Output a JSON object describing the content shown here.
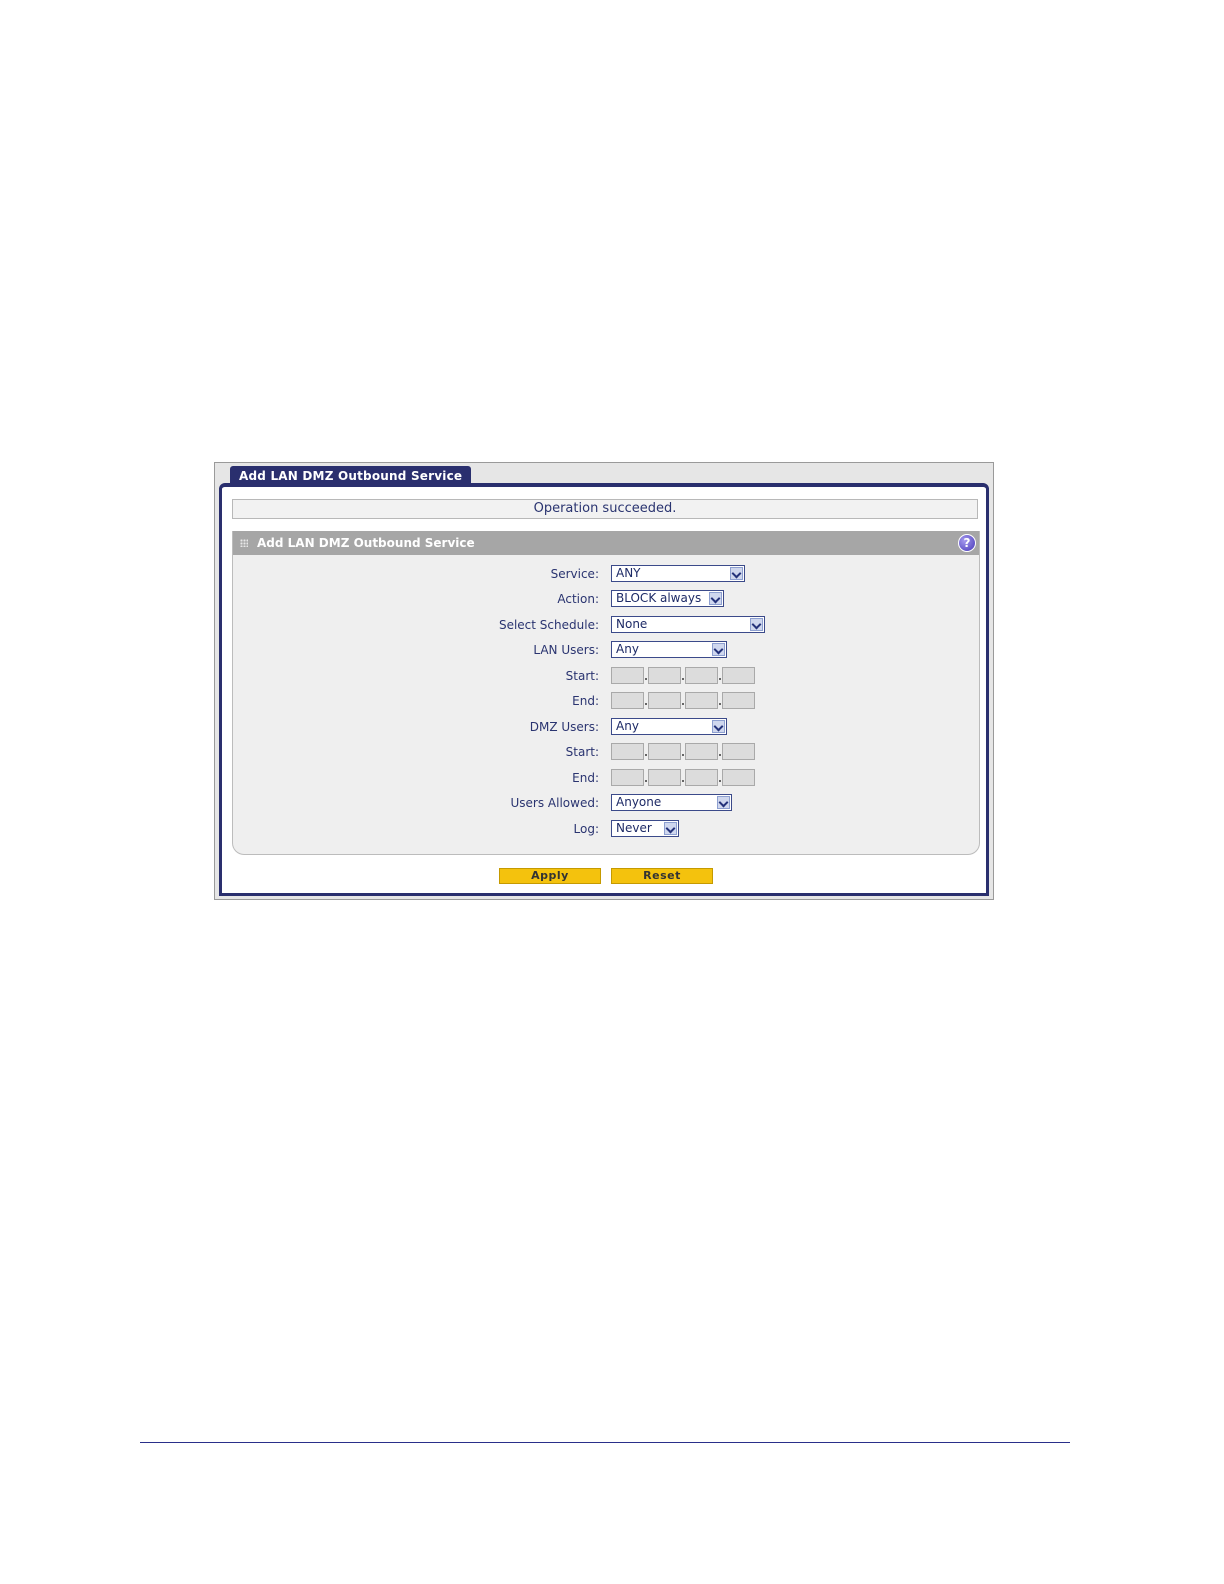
{
  "tab": {
    "label": "Add LAN DMZ Outbound Service"
  },
  "status": {
    "message": "Operation succeeded."
  },
  "panel": {
    "title": "Add LAN DMZ Outbound Service",
    "help": "?"
  },
  "form": {
    "service": {
      "label": "Service:",
      "value": "ANY"
    },
    "action": {
      "label": "Action:",
      "value": "BLOCK always"
    },
    "schedule": {
      "label": "Select Schedule:",
      "value": "None"
    },
    "lan_users": {
      "label": "LAN Users:",
      "value": "Any"
    },
    "lan_start": {
      "label": "Start:"
    },
    "lan_end": {
      "label": "End:"
    },
    "dmz_users": {
      "label": "DMZ Users:",
      "value": "Any"
    },
    "dmz_start": {
      "label": "Start:"
    },
    "dmz_end": {
      "label": "End:"
    },
    "users_allowed": {
      "label": "Users Allowed:",
      "value": "Anyone"
    },
    "log": {
      "label": "Log:",
      "value": "Never"
    }
  },
  "buttons": {
    "apply": "Apply",
    "reset": "Reset"
  },
  "colors": {
    "nav": "#2a2f6e",
    "button": "#f4c20d",
    "panel_header": "#a6a6a6"
  }
}
